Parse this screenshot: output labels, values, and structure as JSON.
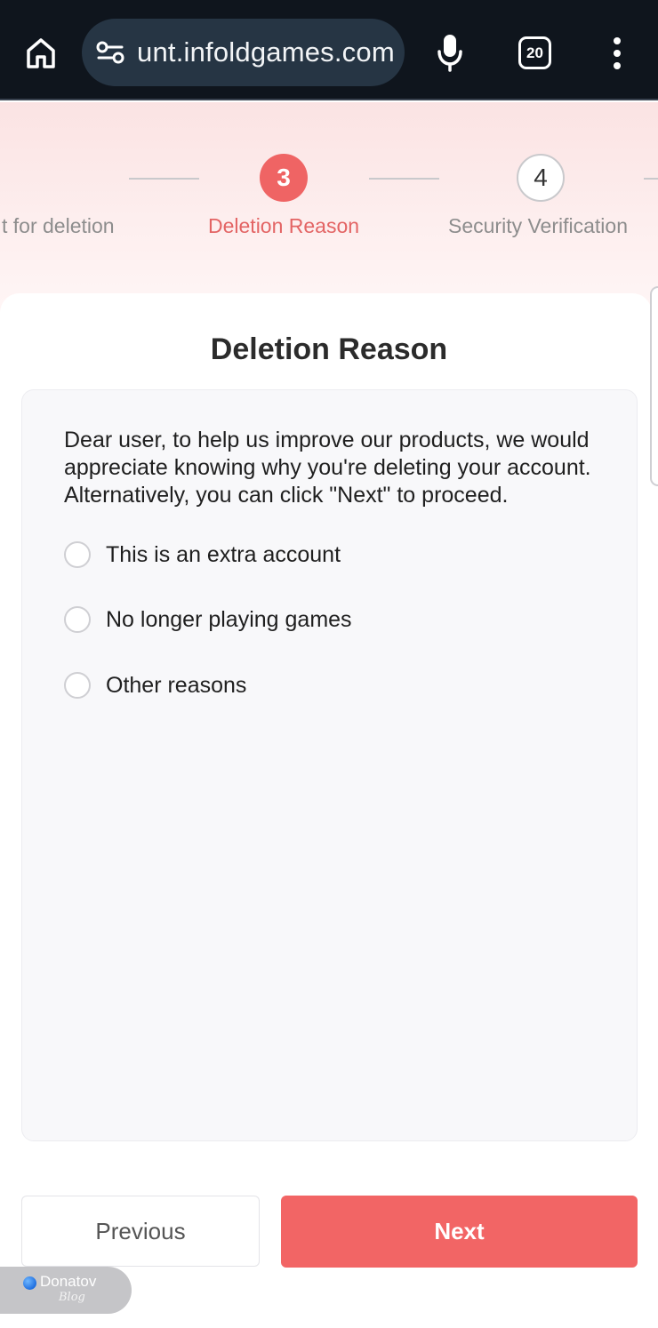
{
  "browser": {
    "url": "unt.infoldgames.com",
    "tab_count": "20"
  },
  "stepper": {
    "steps": [
      {
        "number": "",
        "label": "t for deletion",
        "state": "done"
      },
      {
        "number": "3",
        "label": "Deletion Reason",
        "state": "active"
      },
      {
        "number": "4",
        "label": "Security Verification",
        "state": "pending"
      }
    ]
  },
  "card": {
    "title": "Deletion Reason",
    "intro": "Dear user, to help us improve our products, we would appreciate knowing why you're deleting your account. Alternatively, you can click \"Next\" to proceed.",
    "options": [
      {
        "label": "This is an extra account",
        "selected": false
      },
      {
        "label": "No longer playing games",
        "selected": false
      },
      {
        "label": "Other reasons",
        "selected": false
      }
    ]
  },
  "footer": {
    "previous_label": "Previous",
    "next_label": "Next"
  },
  "watermark": {
    "name": "Donatov",
    "sub": "Blog"
  },
  "colors": {
    "accent": "#f26565",
    "active_step_text": "#e36464",
    "browser_bg": "#0f151d",
    "url_pill": "#263544"
  },
  "icons": {
    "home": "home-icon",
    "site_info": "site-settings-icon",
    "mic": "microphone-icon",
    "tabs": "tab-switcher-icon",
    "menu": "more-vert-icon"
  }
}
